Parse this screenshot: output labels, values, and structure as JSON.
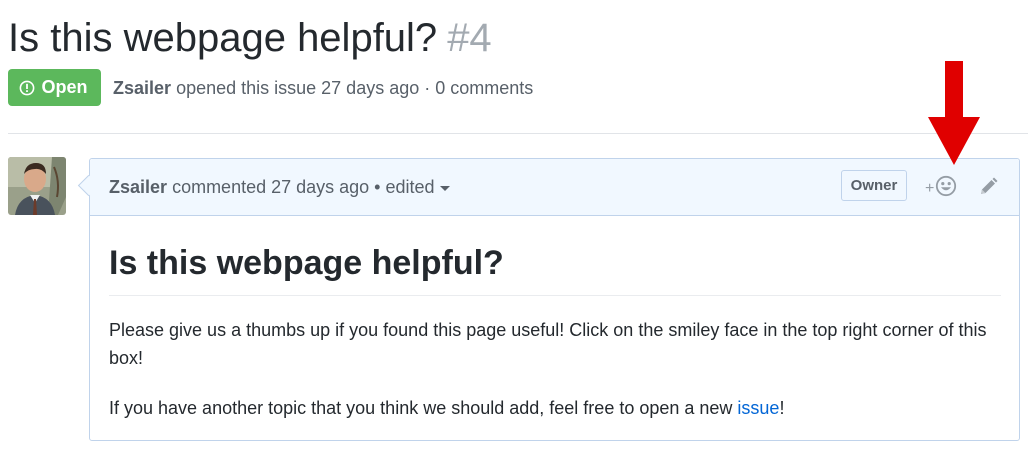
{
  "issue": {
    "title": "Is this webpage helpful?",
    "number": "#4",
    "state_label": "Open",
    "author": "Zsailer",
    "opened_text": "opened this issue 27 days ago · 0 comments"
  },
  "comment": {
    "author": "Zsailer",
    "commented_text": "commented 27 days ago •",
    "edited_label": "edited",
    "owner_label": "Owner",
    "reaction_plus": "+",
    "body": {
      "heading": "Is this webpage helpful?",
      "paragraph1": "Please give us a thumbs up if you found this page useful! Click on the smiley face in the top right corner of this box!",
      "paragraph2_before": "If you have another topic that you think we should add, feel free to open a new ",
      "paragraph2_link": "issue",
      "paragraph2_after": "!"
    }
  },
  "icons": {
    "state": "issue-opened-icon",
    "reaction": "smiley-icon",
    "edit": "pencil-icon",
    "arrow": "red-down-arrow"
  },
  "colors": {
    "open_badge": "#5cb85c",
    "link": "#0366d6",
    "header_bg": "#f1f8ff",
    "arrow": "#e00000"
  }
}
